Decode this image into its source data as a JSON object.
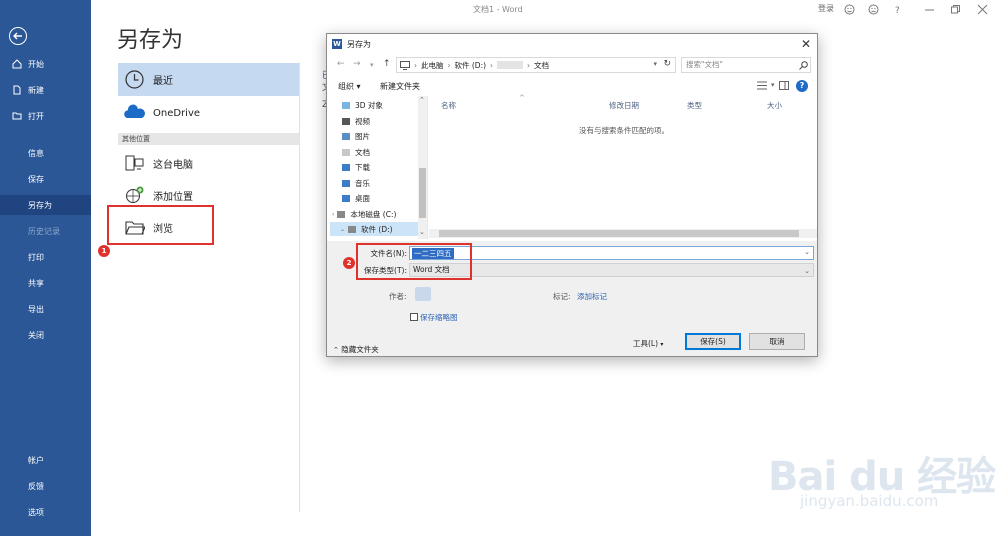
{
  "window": {
    "title": "文档1 - Word",
    "user": "登录"
  },
  "nav": {
    "items": [
      {
        "label": "开始",
        "icon": "home-icon"
      },
      {
        "label": "新建",
        "icon": "new-doc-icon"
      },
      {
        "label": "打开",
        "icon": "open-folder-icon"
      },
      {
        "label": "信息"
      },
      {
        "label": "保存"
      },
      {
        "label": "另存为",
        "active": true
      },
      {
        "label": "历史记录",
        "disabled": true
      },
      {
        "label": "打印"
      },
      {
        "label": "共享"
      },
      {
        "label": "导出"
      },
      {
        "label": "关闭"
      },
      {
        "label": "帐户"
      },
      {
        "label": "反馈"
      },
      {
        "label": "选项"
      }
    ]
  },
  "backstage": {
    "title": "另存为",
    "recent_label": "最近",
    "onedrive_label": "OneDrive",
    "other_locations": "其他位置",
    "this_pc_label": "这台电脑",
    "add_place_label": "添加位置",
    "browse_label": "浏览",
    "partial_right": [
      "已",
      "文",
      "Z"
    ]
  },
  "steps": {
    "one": "1",
    "two": "2"
  },
  "dialog": {
    "title": "另存为",
    "close": "✕",
    "breadcrumb": [
      "此电脑",
      "软件 (D:)",
      "文档"
    ],
    "search_placeholder": "搜索\"文档\"",
    "toolbar": {
      "organize": "组织 ▾",
      "new_folder": "新建文件夹"
    },
    "help": "?",
    "tree": [
      {
        "label": "3D 对象"
      },
      {
        "label": "视频"
      },
      {
        "label": "图片"
      },
      {
        "label": "文档"
      },
      {
        "label": "下载"
      },
      {
        "label": "音乐"
      },
      {
        "label": "桌面"
      },
      {
        "label": "本地磁盘 (C:)"
      },
      {
        "label": "软件 (D:)",
        "selected": true
      }
    ],
    "columns": [
      "名称",
      "修改日期",
      "类型",
      "大小"
    ],
    "empty_message": "没有与搜索条件匹配的项。",
    "filename_label": "文件名(N):",
    "filename_value": "一二三四五",
    "filetype_label": "保存类型(T):",
    "filetype_value": "Word 文档",
    "author_label": "作者:",
    "tags_label": "标记:",
    "tags_link": "添加标记",
    "thumbnail_label": "保存缩略图",
    "hide_folders": "隐藏文件夹",
    "tools": "工具(L)",
    "save": "保存(S)",
    "cancel": "取消"
  },
  "watermark": {
    "logo": "Bai du 经验",
    "url": "jingyan.baidu.com"
  }
}
